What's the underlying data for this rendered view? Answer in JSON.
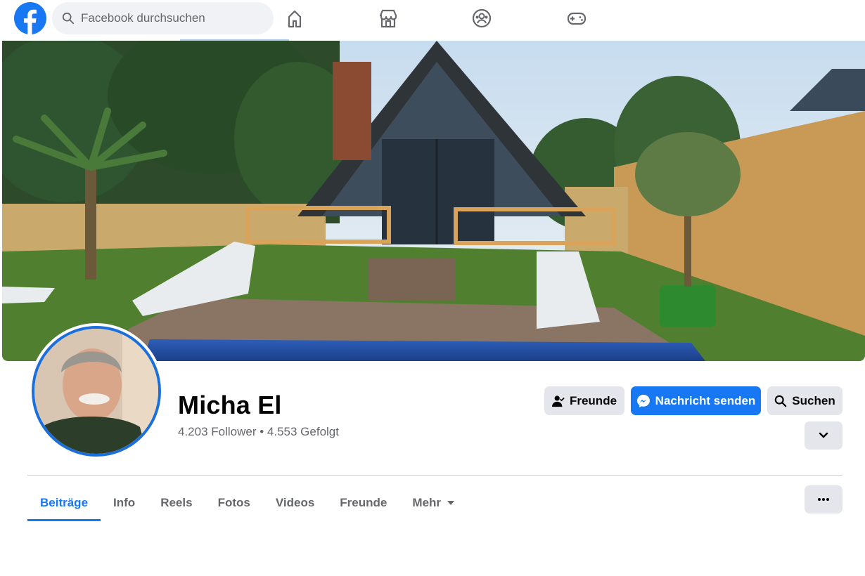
{
  "search": {
    "placeholder": "Facebook durchsuchen"
  },
  "profile": {
    "name": "Micha El",
    "stats": "4.203 Follower • 4.553 Gefolgt"
  },
  "actions": {
    "friends_label": "Freunde",
    "message_label": "Nachricht senden",
    "search_label": "Suchen"
  },
  "tabs": [
    {
      "label": "Beiträge",
      "active": true
    },
    {
      "label": "Info"
    },
    {
      "label": "Reels"
    },
    {
      "label": "Fotos"
    },
    {
      "label": "Videos"
    },
    {
      "label": "Freunde"
    },
    {
      "label": "Mehr"
    }
  ],
  "icons": {
    "logo": "facebook-logo-icon",
    "nav": [
      "home-icon",
      "marketplace-icon",
      "groups-icon",
      "gaming-icon"
    ]
  },
  "colors": {
    "brand": "#1877f2",
    "button_grey": "#e4e6eb",
    "text_secondary": "#65676b"
  }
}
